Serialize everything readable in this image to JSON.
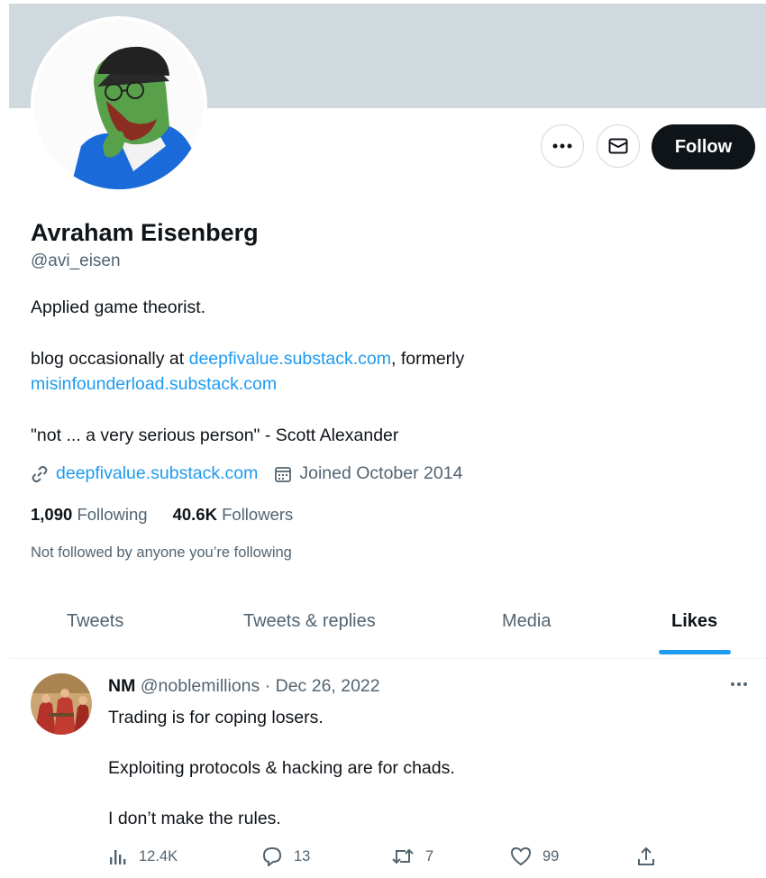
{
  "profile": {
    "name": "Avraham Eisenberg",
    "handle": "@avi_eisen",
    "bio_line1": "Applied game theorist.",
    "bio_line2_prefix": "blog occasionally at ",
    "bio_line2_link1": "deepfivalue.substack.com",
    "bio_line2_mid": ", formerly",
    "bio_line2_link2": "misinfounderload.substack.com",
    "bio_line3": "\"not ... a very serious person\" - Scott Alexander",
    "website": "deepfivalue.substack.com",
    "joined": "Joined October 2014",
    "following_count": "1,090",
    "following_label": "Following",
    "followers_count": "40.6K",
    "followers_label": "Followers",
    "not_followed_text": "Not followed by anyone you’re following"
  },
  "actions": {
    "more_icon": "more-horizontal-icon",
    "message_icon": "envelope-icon",
    "follow_label": "Follow"
  },
  "tabs": [
    {
      "label": "Tweets",
      "active": false
    },
    {
      "label": "Tweets & replies",
      "active": false
    },
    {
      "label": "Media",
      "active": false
    },
    {
      "label": "Likes",
      "active": true
    }
  ],
  "tweet": {
    "author_name": "NM",
    "author_handle": "@noblemillions",
    "separator": "·",
    "date": "Dec 26, 2022",
    "line1": "Trading is for coping losers.",
    "line2": "Exploiting protocols & hacking are for chads.",
    "line3": "I don’t make the rules.",
    "views": "12.4K",
    "replies": "13",
    "retweets": "7",
    "likes": "99"
  },
  "colors": {
    "accent": "#1d9bf0",
    "text": "#0f1419",
    "secondary": "#536471",
    "banner": "#cfd9de"
  }
}
